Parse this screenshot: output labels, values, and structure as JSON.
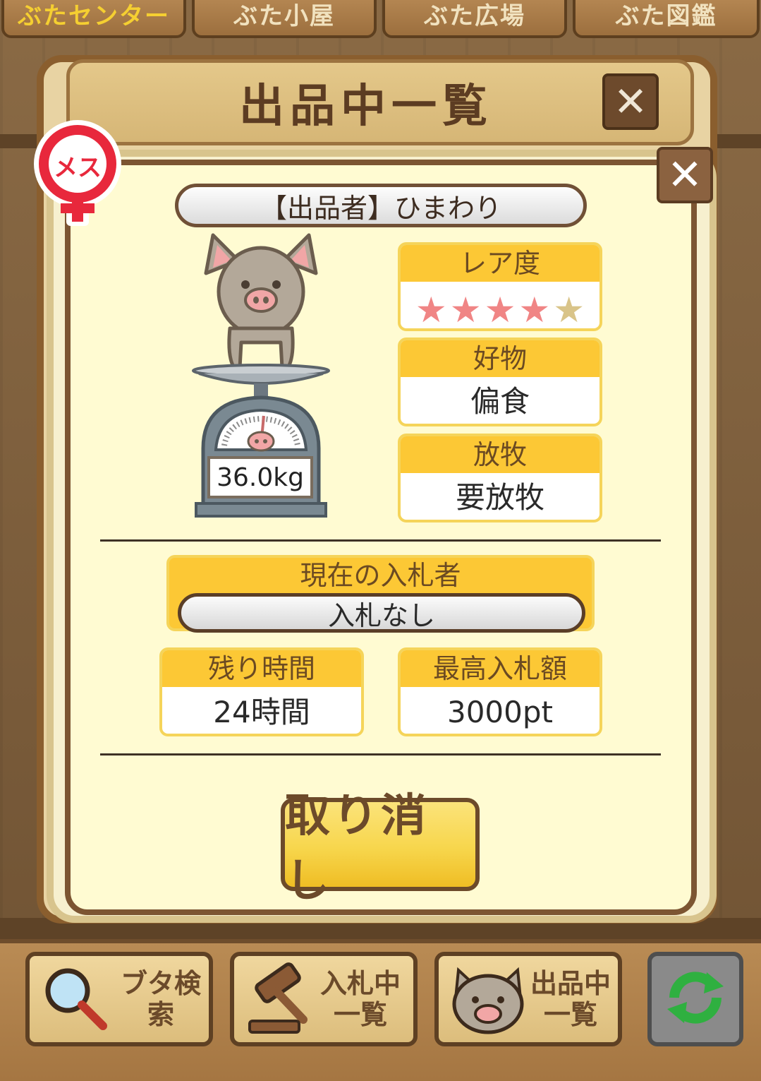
{
  "top_tabs": [
    "ぶたセンター",
    "ぶた小屋",
    "ぶた広場",
    "ぶた図鑑"
  ],
  "back_panel": {
    "title": "出品中一覧",
    "close_symbol": "✕"
  },
  "front_panel": {
    "close_symbol": "✕",
    "gender_badge": "メス",
    "seller_label": "【出品者】ひまわり",
    "weight": "36.0kg",
    "rarity": {
      "label": "レア度",
      "stars_filled": 4,
      "stars_total": 5
    },
    "favorite": {
      "label": "好物",
      "value": "偏食"
    },
    "grazing": {
      "label": "放牧",
      "value": "要放牧"
    },
    "current_bidder": {
      "label": "現在の入札者",
      "value": "入札なし"
    },
    "remaining_time": {
      "label": "残り時間",
      "value": "24時間"
    },
    "highest_bid": {
      "label": "最高入札額",
      "value": "3000pt"
    },
    "cancel_button": "取り消し"
  },
  "bottom_nav": {
    "search": {
      "label": "ブタ検索",
      "icon": "magnifier-icon"
    },
    "bidding": {
      "label_line1": "入札中",
      "label_line2": "一覧",
      "icon": "gavel-icon"
    },
    "listing": {
      "label_line1": "出品中",
      "label_line2": "一覧",
      "icon": "pig-face-icon"
    },
    "refresh": {
      "icon": "refresh-icon"
    }
  },
  "colors": {
    "accent_yellow": "#fcc835",
    "panel_bg": "#fffbd2",
    "frame_brown": "#7c5532",
    "star_on": "#f08585",
    "star_off": "#d9c489",
    "gender_red": "#e8283c"
  }
}
